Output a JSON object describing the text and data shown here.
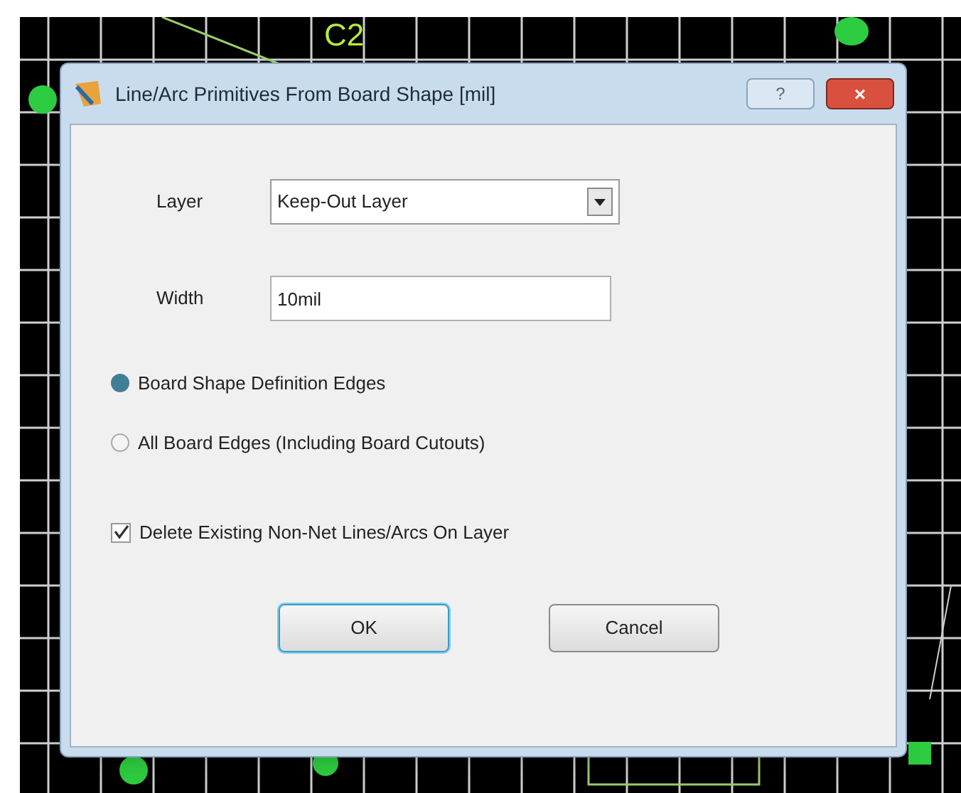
{
  "canvas": {
    "labels": [
      "C2"
    ]
  },
  "dialog": {
    "title": "Line/Arc Primitives From Board Shape [mil]",
    "help_button": "?",
    "close_button": "×",
    "layer": {
      "label": "Layer",
      "value": "Keep-Out Layer"
    },
    "width": {
      "label": "Width",
      "value": "10mil"
    },
    "options": [
      {
        "label": "Board Shape Definition Edges",
        "selected": true
      },
      {
        "label": "All Board Edges (Including Board Cutouts)",
        "selected": false
      }
    ],
    "delete_existing": {
      "label": "Delete Existing Non-Net Lines/Arcs On Layer",
      "checked": true
    },
    "buttons": [
      {
        "label": "OK",
        "default": true
      },
      {
        "label": "Cancel",
        "default": false
      }
    ]
  }
}
